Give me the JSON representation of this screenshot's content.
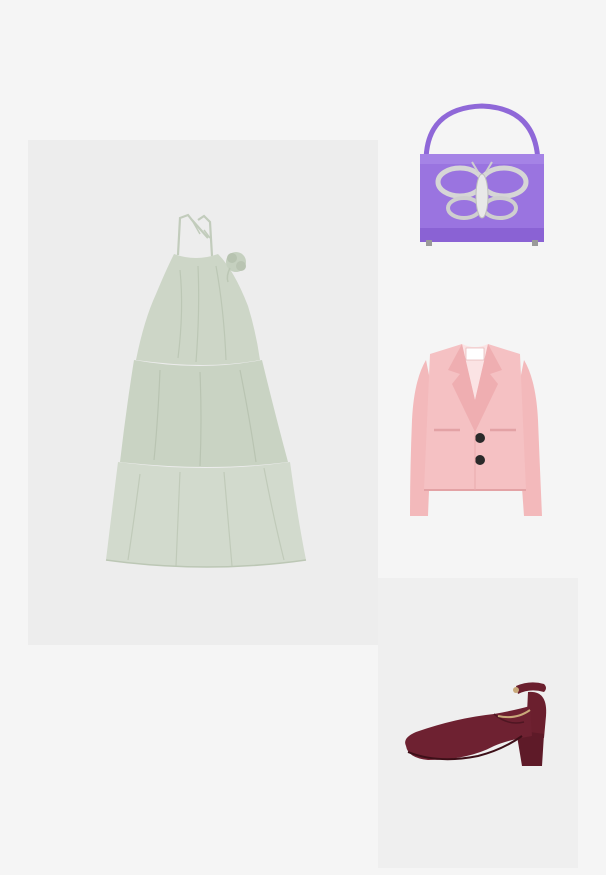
{
  "outfit": {
    "items": [
      {
        "kind": "dress",
        "color": "#c9d3c3",
        "icon": "tiered-halter-dress"
      },
      {
        "kind": "handbag",
        "color": "#9a74e0",
        "icon": "butterfly-clasp-bag"
      },
      {
        "kind": "blazer",
        "color": "#f3b9bb",
        "icon": "cropped-blazer"
      },
      {
        "kind": "shoe",
        "color": "#6b1f2e",
        "icon": "ankle-strap-pump"
      }
    ]
  }
}
